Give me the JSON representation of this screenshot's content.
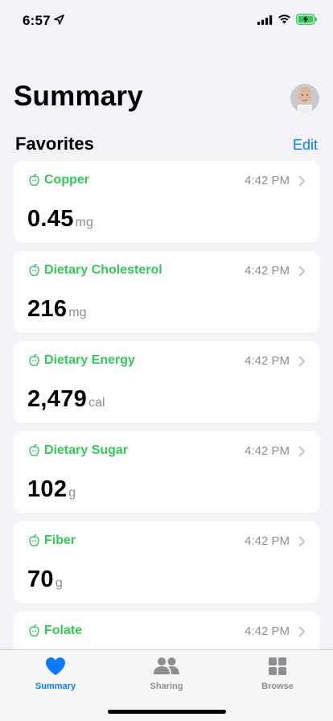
{
  "status": {
    "time": "6:57"
  },
  "header": {
    "title": "Summary"
  },
  "favorites": {
    "title": "Favorites",
    "edit_label": "Edit",
    "items": [
      {
        "name": "Copper",
        "time": "4:42 PM",
        "value": "0.45",
        "unit": "mg"
      },
      {
        "name": "Dietary Cholesterol",
        "time": "4:42 PM",
        "value": "216",
        "unit": "mg"
      },
      {
        "name": "Dietary Energy",
        "time": "4:42 PM",
        "value": "2,479",
        "unit": "cal"
      },
      {
        "name": "Dietary Sugar",
        "time": "4:42 PM",
        "value": "102",
        "unit": "g"
      },
      {
        "name": "Fiber",
        "time": "4:42 PM",
        "value": "70",
        "unit": "g"
      },
      {
        "name": "Folate",
        "time": "4:42 PM",
        "value": "",
        "unit": ""
      }
    ]
  },
  "tabs": [
    {
      "label": "Summary",
      "icon": "heart-icon",
      "active": true
    },
    {
      "label": "Sharing",
      "icon": "people-icon",
      "active": false
    },
    {
      "label": "Browse",
      "icon": "grid-icon",
      "active": false
    }
  ],
  "colors": {
    "accent": "#0a7aff",
    "category_green": "#34c759",
    "secondary_text": "#8e8e93",
    "background": "#f2f2f7"
  }
}
